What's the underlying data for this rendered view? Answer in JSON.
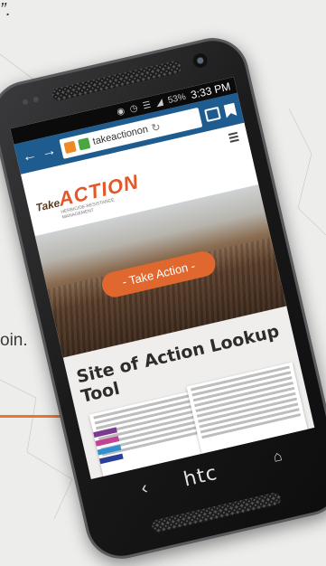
{
  "background": {
    "quote_top": "”.",
    "side_word": "oin.",
    "quote_bottom": "“",
    "accent_color": "#e8772e"
  },
  "phone": {
    "brand_logo": "htc",
    "nav_back_icon": "back-arrow-icon",
    "nav_home_icon": "home-icon"
  },
  "statusbar": {
    "battery": "53%",
    "time": "3:33 PM",
    "icons": [
      "signal-icon",
      "alarm-icon",
      "wifi-icon",
      "battery-icon"
    ]
  },
  "browser": {
    "url": "takeactionon",
    "bar_color": "#1e5b8f"
  },
  "site": {
    "logo_take": "Take",
    "logo_action": "ACTION",
    "logo_tagline": "HERBICIDE-RESISTANCE MANAGEMENT",
    "cta_label": "- Take Action -",
    "tool_title": "Site of Action Lookup Tool",
    "brand_color": "#e0672e"
  }
}
